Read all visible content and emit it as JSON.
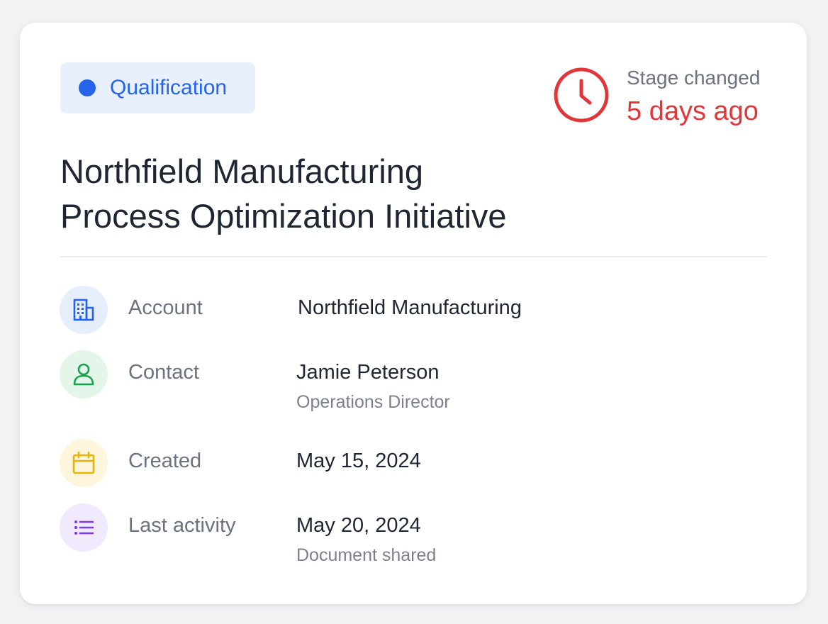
{
  "stage": {
    "label": "Qualification",
    "color": "#2563eb"
  },
  "stage_change": {
    "caption": "Stage changed",
    "ago": "5 days ago",
    "icon": "clock-icon",
    "color": "#e0383a"
  },
  "title": {
    "line1": "Northfield Manufacturing",
    "line2": "Process Optimization Initiative"
  },
  "details": {
    "account": {
      "icon": "building-icon",
      "label": "Account",
      "value": "Northfield Manufacturing",
      "color": "#2563eb"
    },
    "contact": {
      "icon": "user-icon",
      "label": "Contact",
      "value": "Jamie Peterson",
      "sub": "Operations Director",
      "color": "#16a34a"
    },
    "created": {
      "icon": "calendar-icon",
      "label": "Created",
      "value": "May 15, 2024",
      "color": "#eab308"
    },
    "last_activity": {
      "icon": "list-icon",
      "label": "Last activity",
      "value": "May 20, 2024",
      "sub": "Document shared",
      "color": "#7c3aed"
    }
  }
}
